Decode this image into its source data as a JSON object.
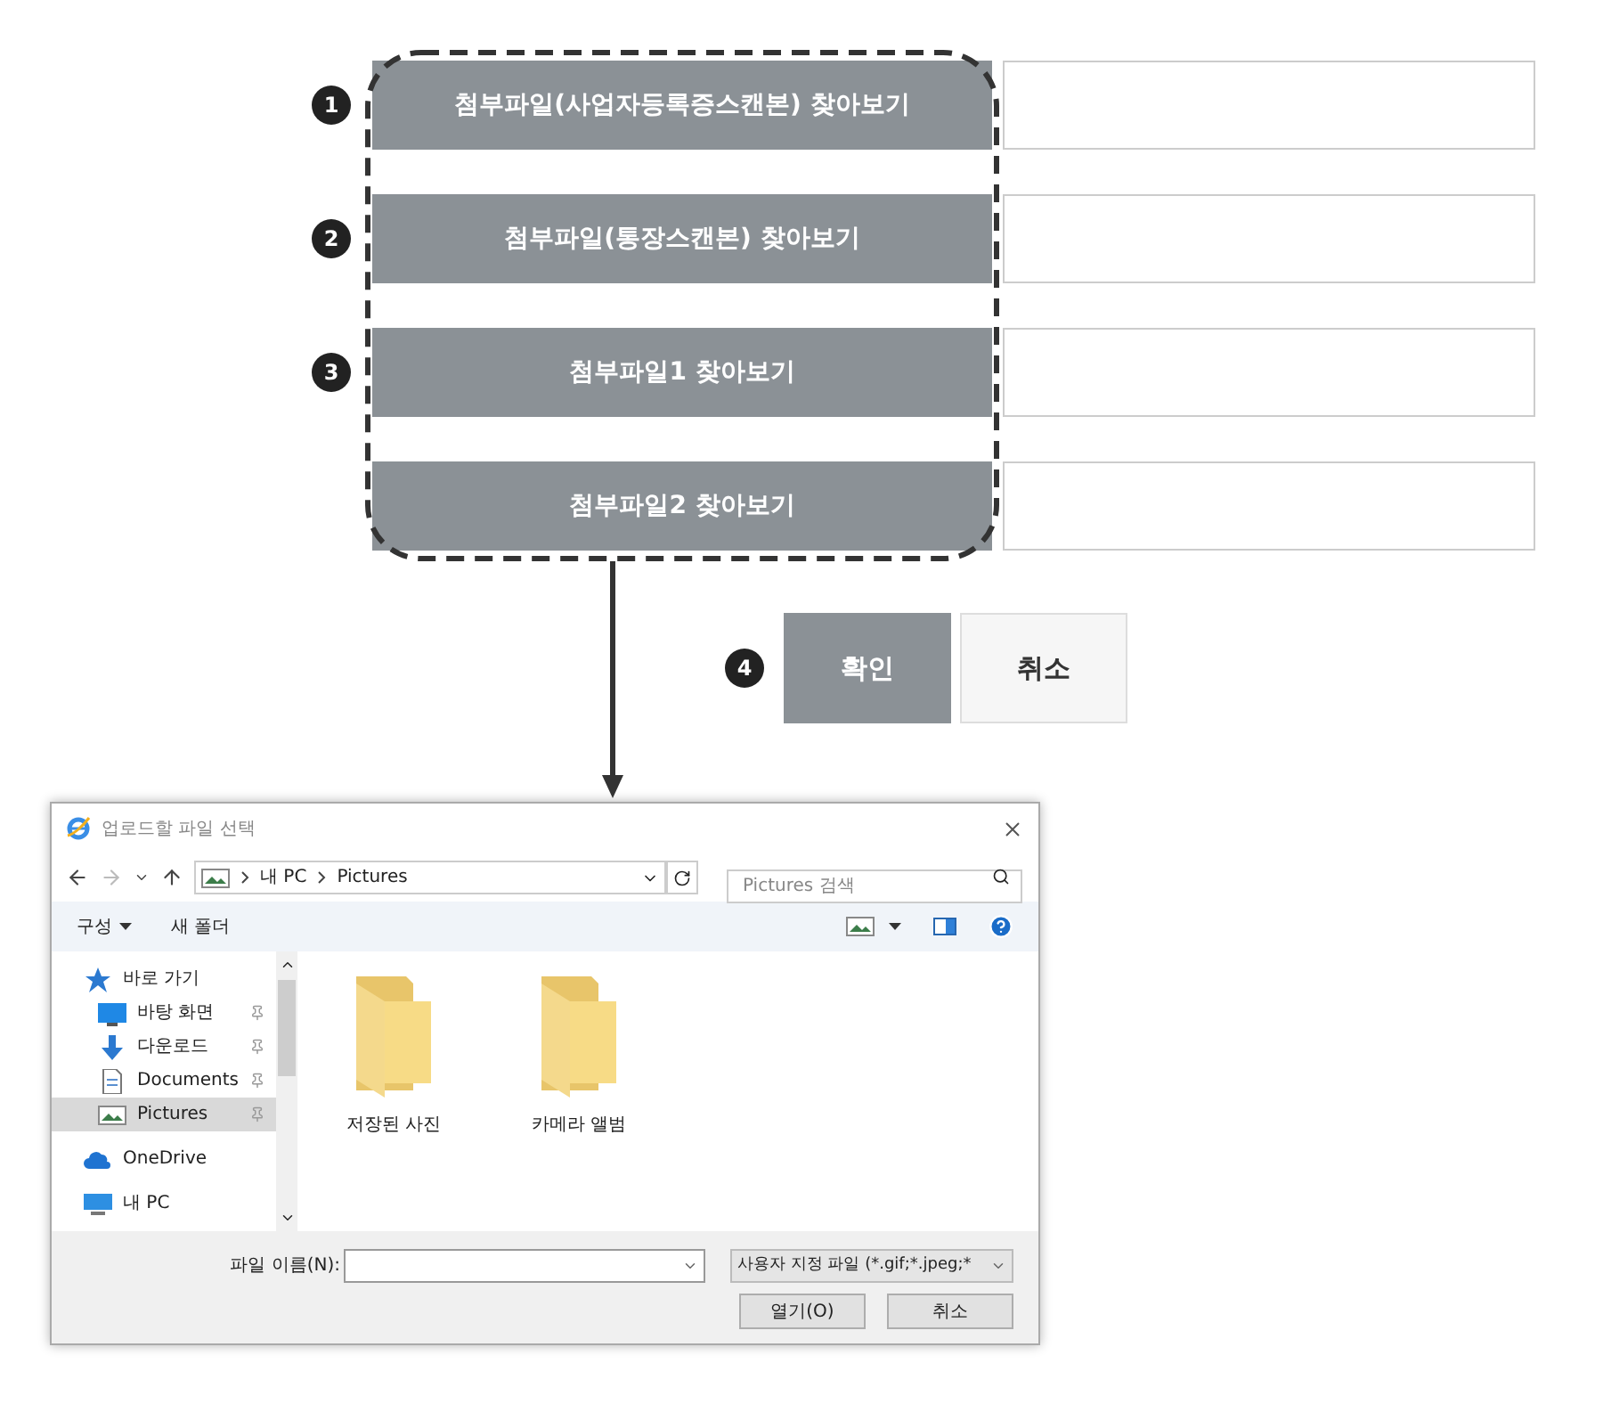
{
  "form": {
    "file_rows": [
      {
        "number": "1",
        "label": "첨부파일(사업자등록증스캔본) 찾아보기"
      },
      {
        "number": "2",
        "label": "첨부파일(통장스캔본) 찾아보기"
      },
      {
        "number": "3",
        "label": "첨부파일1 찾아보기"
      },
      {
        "label": "첨부파일2 찾아보기"
      }
    ],
    "actions": {
      "number": "4",
      "buttons": [
        {
          "label": "확인",
          "kind": "primary"
        },
        {
          "label": "취소",
          "kind": "secondary"
        }
      ]
    }
  },
  "dialog": {
    "title": "업로드할 파일 선택",
    "path": [
      "내 PC",
      "Pictures"
    ],
    "search": {
      "placeholder": "Pictures 검색"
    },
    "toolbar": [
      {
        "label": "구성",
        "kind": "menu"
      },
      {
        "label": "새 폴더",
        "kind": "plain"
      }
    ],
    "nav": [
      {
        "label": "바로 가기",
        "kind": "star",
        "selected": false,
        "children": [
          {
            "label": "바탕 화면",
            "kind": "desktop",
            "pinned": true,
            "selected": false
          },
          {
            "label": "다운로드",
            "kind": "download",
            "pinned": true,
            "selected": false
          },
          {
            "label": "Documents",
            "kind": "document",
            "pinned": true,
            "selected": false
          },
          {
            "label": "Pictures",
            "kind": "pictures",
            "pinned": true,
            "selected": true
          }
        ]
      },
      {
        "label": "OneDrive",
        "kind": "cloud",
        "selected": false
      },
      {
        "label": "내 PC",
        "kind": "pc",
        "selected": false
      }
    ],
    "folders": [
      "저장된 사진",
      "카메라 앨범"
    ],
    "file_name_label": "파일 이름(N):",
    "file_type": "사용자 지정 파일 (*.gif;*.jpeg;*",
    "buttons": [
      "열기(O)",
      "취소"
    ]
  }
}
